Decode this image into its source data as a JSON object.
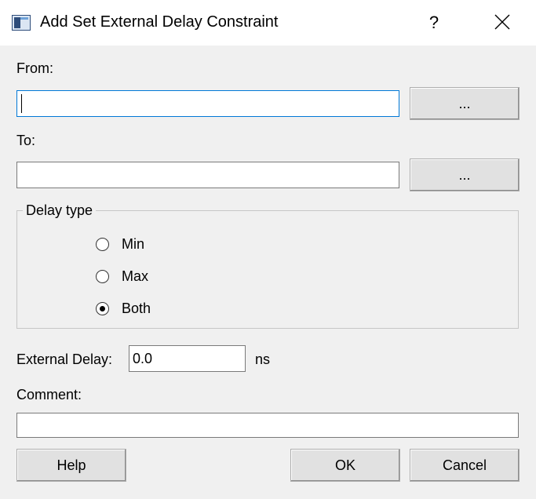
{
  "window": {
    "title": "Add Set External Delay Constraint",
    "help_label": "?"
  },
  "from": {
    "label": "From:",
    "value": "",
    "browse_label": "..."
  },
  "to": {
    "label": "To:",
    "value": "",
    "browse_label": "..."
  },
  "delay_type": {
    "legend": "Delay type",
    "options": [
      {
        "label": "Min",
        "checked": false
      },
      {
        "label": "Max",
        "checked": false
      },
      {
        "label": "Both",
        "checked": true
      }
    ]
  },
  "external_delay": {
    "label": "External Delay:",
    "value": "0.0",
    "unit": "ns"
  },
  "comment": {
    "label": "Comment:",
    "value": ""
  },
  "buttons": {
    "help": "Help",
    "ok": "OK",
    "cancel": "Cancel"
  }
}
